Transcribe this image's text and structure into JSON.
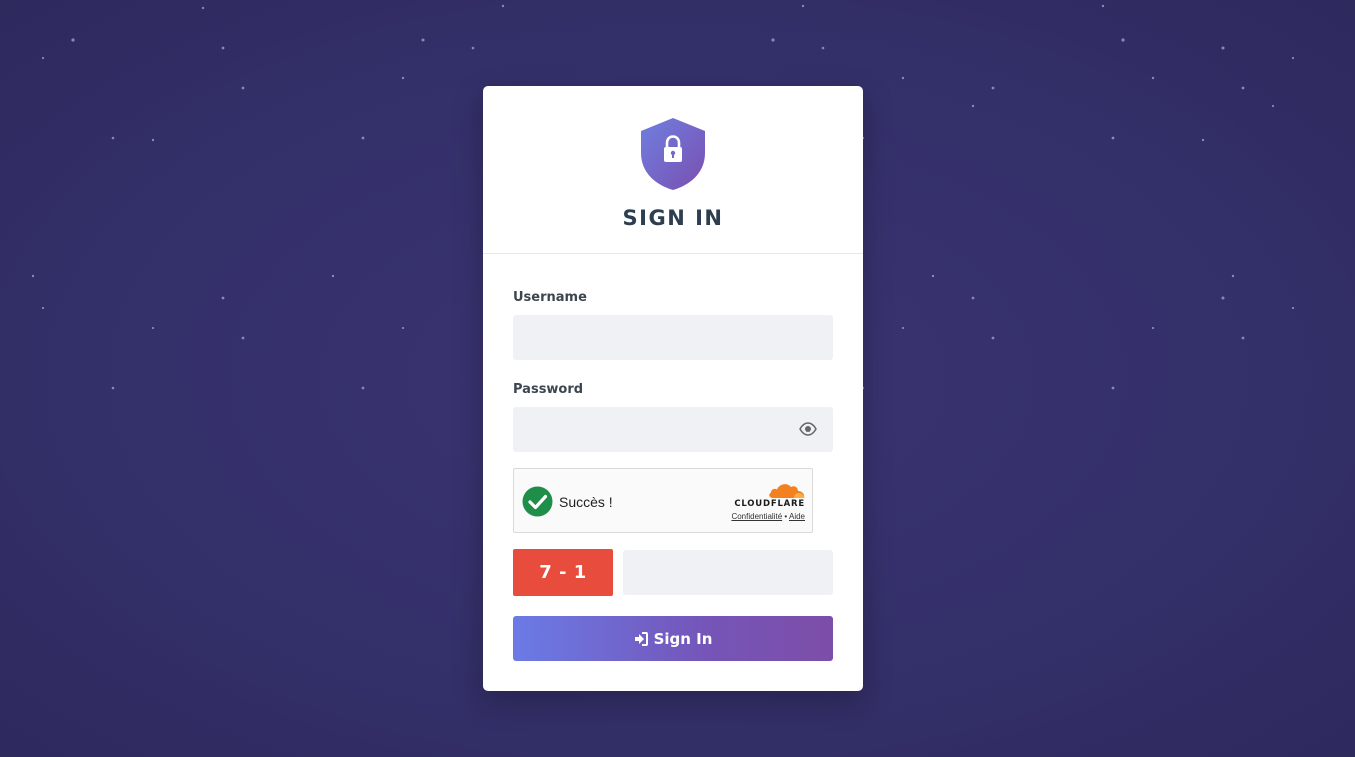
{
  "header": {
    "title": "SIGN IN",
    "logo_icon": "shield-lock-icon"
  },
  "form": {
    "username_label": "Username",
    "username_value": "",
    "password_label": "Password",
    "password_value": "",
    "password_toggle_icon": "eye-icon",
    "captcha_widget": {
      "status_text": "Succès !",
      "status_icon": "check-circle-icon",
      "brand": "CLOUDFLARE",
      "privacy_link": "Confidentialité",
      "separator": "•",
      "help_link": "Aide"
    },
    "math_challenge": {
      "expression": "7 - 1",
      "answer_value": ""
    },
    "submit_label": "Sign In",
    "submit_icon": "sign-in-icon"
  },
  "colors": {
    "background": "#34306a",
    "accent_start": "#6b7be6",
    "accent_end": "#7d4ea8",
    "challenge_red": "#e74c3c",
    "success_green": "#1e8e4a",
    "cloudflare_orange": "#f48120"
  }
}
